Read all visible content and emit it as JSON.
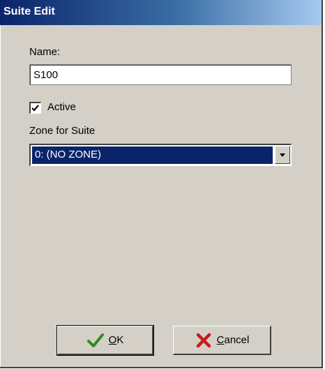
{
  "window": {
    "title": "Suite Edit"
  },
  "form": {
    "name_label": "Name:",
    "name_value": "S100",
    "active_label": "Active",
    "active_checked": true,
    "zone_label": "Zone for Suite",
    "zone_selected": "0: (NO ZONE)"
  },
  "buttons": {
    "ok_accel": "O",
    "ok_rest": "K",
    "ok_icon": "checkmark-icon",
    "cancel_accel": "C",
    "cancel_rest": "ancel",
    "cancel_icon": "red-x-icon"
  },
  "colors": {
    "title_bar": "#0a246a",
    "dialog_face": "#d4d0c8",
    "selection": "#0a246a",
    "ok_icon": "#2e8b1e",
    "cancel_icon": "#cc1a1a"
  }
}
